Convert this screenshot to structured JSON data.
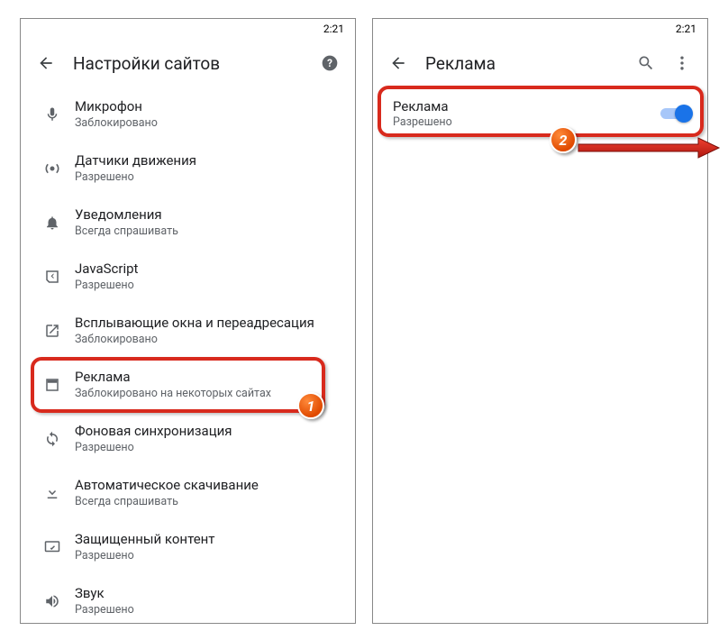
{
  "left": {
    "status": {
      "time": "2:21"
    },
    "header": {
      "title": "Настройки сайтов"
    },
    "items": [
      {
        "label": "Микрофон",
        "sub": "Заблокировано",
        "icon": "mic"
      },
      {
        "label": "Датчики движения",
        "sub": "Разрешено",
        "icon": "sensor"
      },
      {
        "label": "Уведомления",
        "sub": "Всегда спрашивать",
        "icon": "bell"
      },
      {
        "label": "JavaScript",
        "sub": "Разрешено",
        "icon": "js"
      },
      {
        "label": "Всплывающие окна и переадресация",
        "sub": "Заблокировано",
        "icon": "popup"
      },
      {
        "label": "Реклама",
        "sub": "Заблокировано на некоторых сайтах",
        "icon": "ads"
      },
      {
        "label": "Фоновая синхронизация",
        "sub": "Разрешено",
        "icon": "sync"
      },
      {
        "label": "Автоматическое скачивание",
        "sub": "Всегда спрашивать",
        "icon": "download"
      },
      {
        "label": "Защищенный контент",
        "sub": "Разрешено",
        "icon": "protected"
      },
      {
        "label": "Звук",
        "sub": "Разрешено",
        "icon": "sound"
      }
    ]
  },
  "right": {
    "status": {
      "time": "2:21"
    },
    "header": {
      "title": "Реклама"
    },
    "toggle": {
      "label": "Реклама",
      "sub": "Разрешено"
    }
  },
  "annotations": {
    "badge1": "1",
    "badge2": "2"
  }
}
